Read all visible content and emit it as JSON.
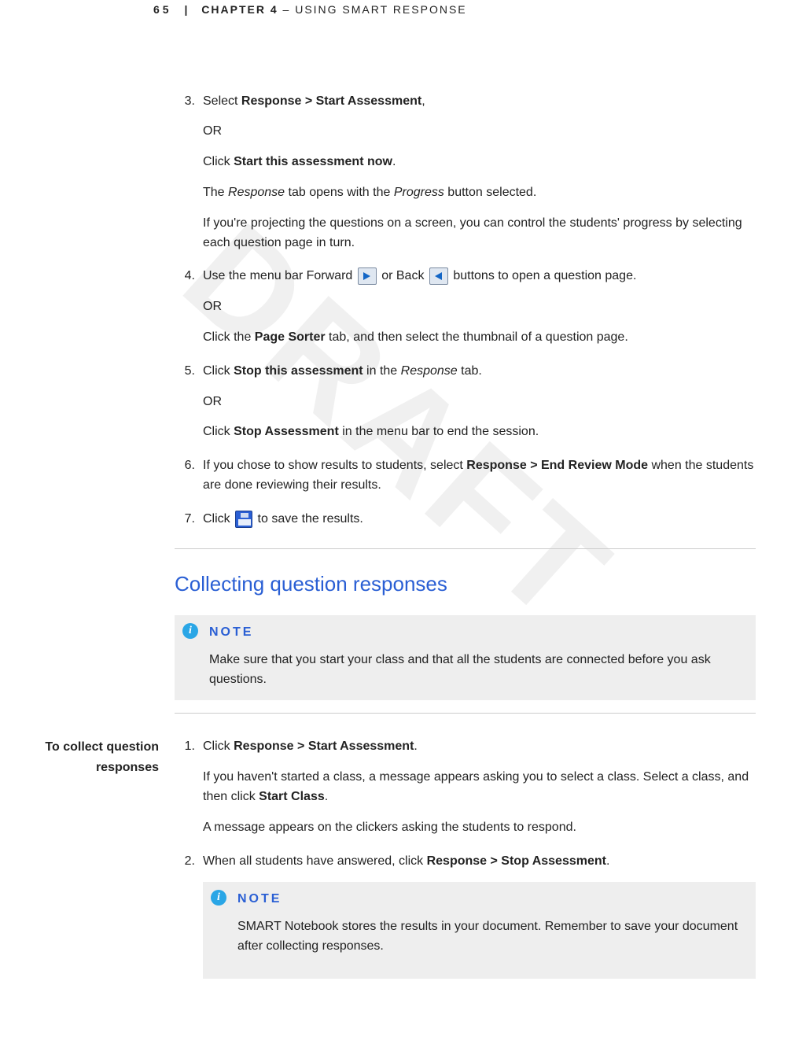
{
  "header": {
    "page_number": "65",
    "chapter_label": "CHAPTER 4",
    "chapter_title": "– USING SMART RESPONSE"
  },
  "watermark": "DRAFT",
  "steps_a": {
    "3": {
      "num": "3.",
      "line1_a": "Select ",
      "line1_b": "Response > Start Assessment",
      "line1_c": ",",
      "or": "OR",
      "line2_a": "Click ",
      "line2_b": "Start this assessment now",
      "line2_c": ".",
      "line3_a": "The ",
      "line3_b": "Response",
      "line3_c": " tab opens with the ",
      "line3_d": "Progress",
      "line3_e": " button selected.",
      "line4": "If you're projecting the questions on a screen, you can control the students' progress by selecting each question page in turn."
    },
    "4": {
      "num": "4.",
      "a": "Use the menu bar Forward ",
      "b": " or Back ",
      "c": " buttons to open a question page.",
      "or": "OR",
      "d": "Click the ",
      "e": "Page Sorter",
      "f": " tab, and then select the thumbnail of a question page."
    },
    "5": {
      "num": "5.",
      "a": "Click ",
      "b": "Stop this assessment",
      "c": " in the ",
      "d": "Response",
      "e": " tab.",
      "or": "OR",
      "f": "Click ",
      "g": "Stop Assessment",
      "h": " in the menu bar to end the session."
    },
    "6": {
      "num": "6.",
      "a": "If you chose to show results to students, select ",
      "b": "Response > End Review Mode",
      "c": " when the students are done reviewing their results."
    },
    "7": {
      "num": "7.",
      "a": "Click ",
      "b": " to save the results."
    }
  },
  "section2": {
    "title": "Collecting question responses",
    "note1": {
      "label": "NOTE",
      "text": "Make sure that you start your class and that all the students are connected before you ask questions."
    },
    "side_label_1": "To collect question",
    "side_label_2": "responses",
    "steps": {
      "1": {
        "num": "1.",
        "a": "Click ",
        "b": "Response > Start Assessment",
        "c": ".",
        "d": "If you haven't started a class, a message appears asking you to select a class. Select a class, and then click ",
        "e": "Start Class",
        "f": ".",
        "g": "A message appears on the clickers asking the students to respond."
      },
      "2": {
        "num": "2.",
        "a": "When all students have answered, click ",
        "b": "Response > Stop Assessment",
        "c": ".",
        "note": {
          "label": "NOTE",
          "text": "SMART Notebook stores the results in your document. Remember to save your document after collecting responses."
        }
      }
    }
  }
}
